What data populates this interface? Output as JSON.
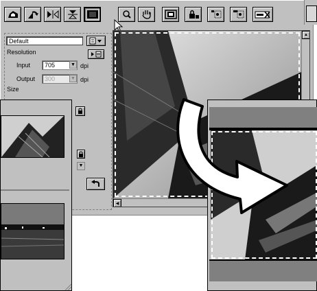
{
  "toolbar": {
    "buttons": [
      {
        "name": "flip-vertical-icon"
      },
      {
        "name": "rotate-icon"
      },
      {
        "name": "mirror-horizontal-icon"
      },
      {
        "name": "mirror-vertical-icon"
      },
      {
        "name": "fit-frame-icon"
      },
      {
        "name": "zoom-icon"
      },
      {
        "name": "hand-icon"
      },
      {
        "name": "auto-crop-icon"
      },
      {
        "name": "lock-icon"
      },
      {
        "name": "highlight-eyedropper-icon"
      },
      {
        "name": "midtone-eyedropper-icon"
      },
      {
        "name": "white-balance-icon"
      }
    ]
  },
  "settings": {
    "preset_value": "Default",
    "resolution_label": "Resolution",
    "input_label": "Input",
    "input_value": "705",
    "input_unit": "dpi",
    "output_label": "Output",
    "output_value": "300",
    "output_unit": "dpi",
    "size_label": "Size"
  },
  "colors": {
    "window_gray": "#c0c0c0",
    "frame_black": "#000000",
    "bar_gray": "#808080"
  }
}
